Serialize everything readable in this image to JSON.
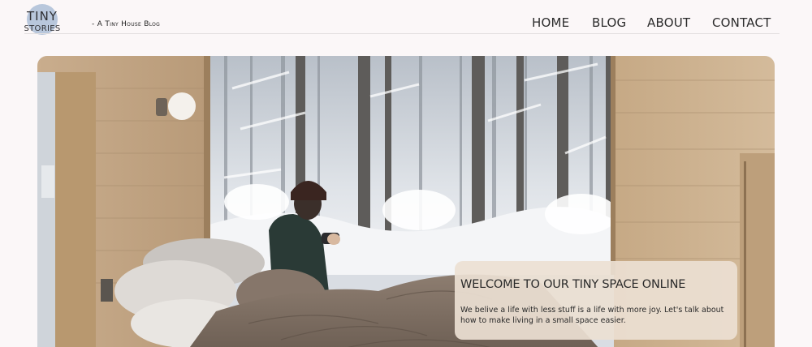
{
  "logo": {
    "line1": "TINY",
    "line2": "STORIES"
  },
  "tagline": "- A Tiny House Blog",
  "nav": {
    "items": [
      {
        "label": "HOME"
      },
      {
        "label": "BLOG"
      },
      {
        "label": "ABOUT"
      },
      {
        "label": "CONTACT"
      }
    ]
  },
  "hero": {
    "image": "woman-in-bed-cabin-snowy-forest-photo",
    "card": {
      "title": "WELCOME TO OUR TINY SPACE ONLINE",
      "text": "We belive a life with less stuff is a life with more joy. Let's talk about how to make living in a small space easier."
    }
  },
  "colors": {
    "background": "#fbf7f8",
    "logo_circle": "#b8c7dc",
    "card": "#ece0d2",
    "text": "#2b2b2b"
  }
}
